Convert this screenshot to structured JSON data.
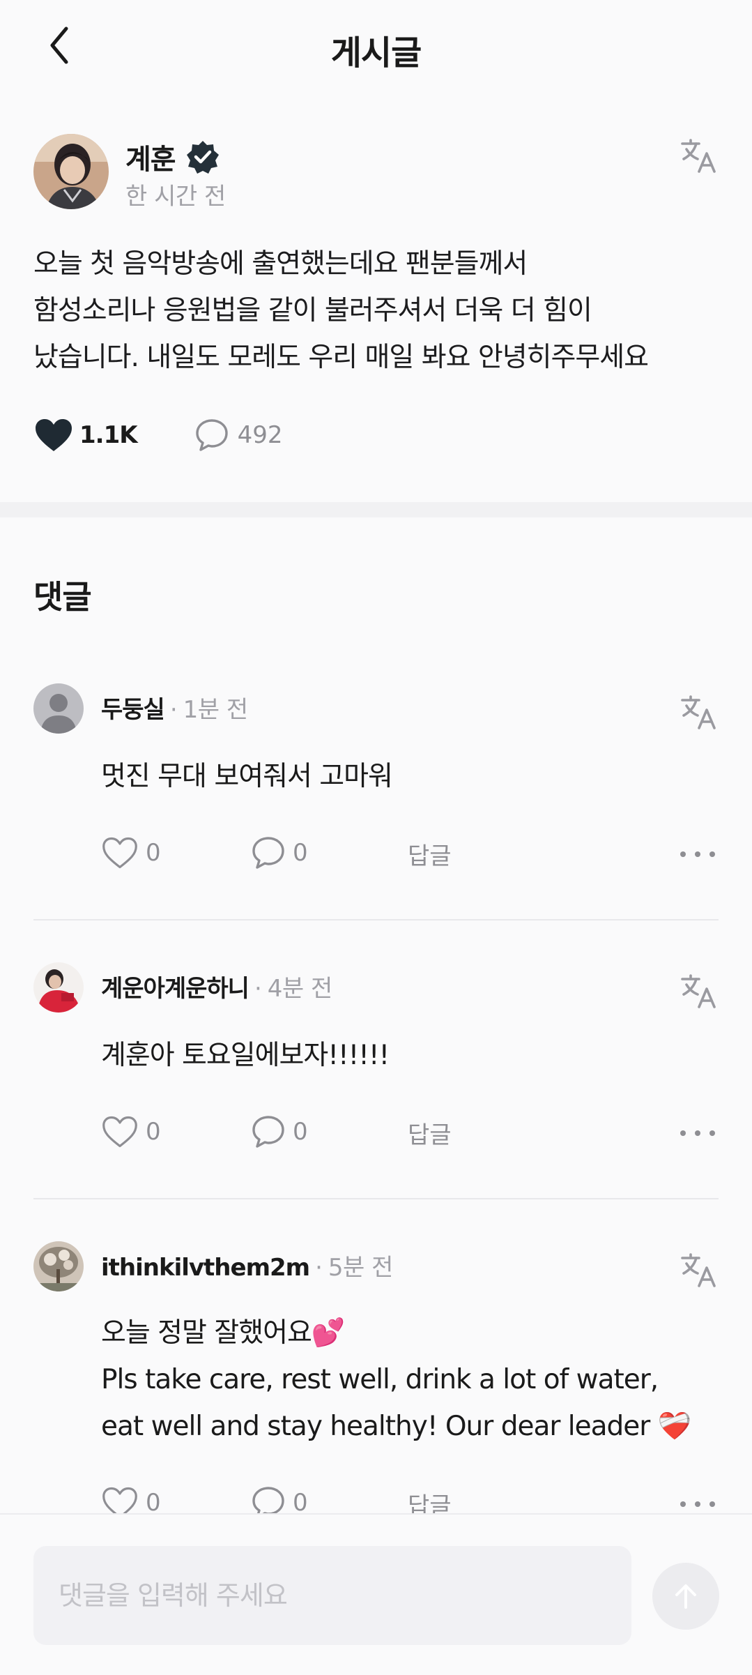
{
  "header": {
    "title": "게시글"
  },
  "post": {
    "author": "계훈",
    "time": "한 시간 전",
    "body": "오늘 첫 음악방송에 출연했는데요  팬분들께서\n함성소리나 응원법을 같이 불러주셔서 더욱 더 힘이\n났습니다. 내일도 모레도 우리 매일 봐요 안녕히주무세요",
    "like_count": "1.1K",
    "comment_count": "492"
  },
  "comments_section": {
    "title": "댓글",
    "separator": "·",
    "reply_label": "답글",
    "items": [
      {
        "name": "두둥실",
        "time": "1분 전",
        "body": "멋진 무대 보여줘서 고마워",
        "likes": "0",
        "replies": "0"
      },
      {
        "name": "계운아계운하니",
        "time": "4분 전",
        "body": "계훈아 토요일에보자!!!!!!",
        "likes": "0",
        "replies": "0"
      },
      {
        "name": "ithinkilvthem2m",
        "time": "5분 전",
        "body": "오늘 정말 잘했어요💕\nPls take care, rest well, drink a lot of water,\neat well and stay healthy! Our dear leader ❤️‍🩹",
        "likes": "0",
        "replies": "0"
      }
    ]
  },
  "composer": {
    "placeholder": "댓글을 입력해 주세요"
  },
  "colors": {
    "icon_dark": "#1f2a33",
    "muted": "#8e8e93",
    "verified": "#243039"
  }
}
